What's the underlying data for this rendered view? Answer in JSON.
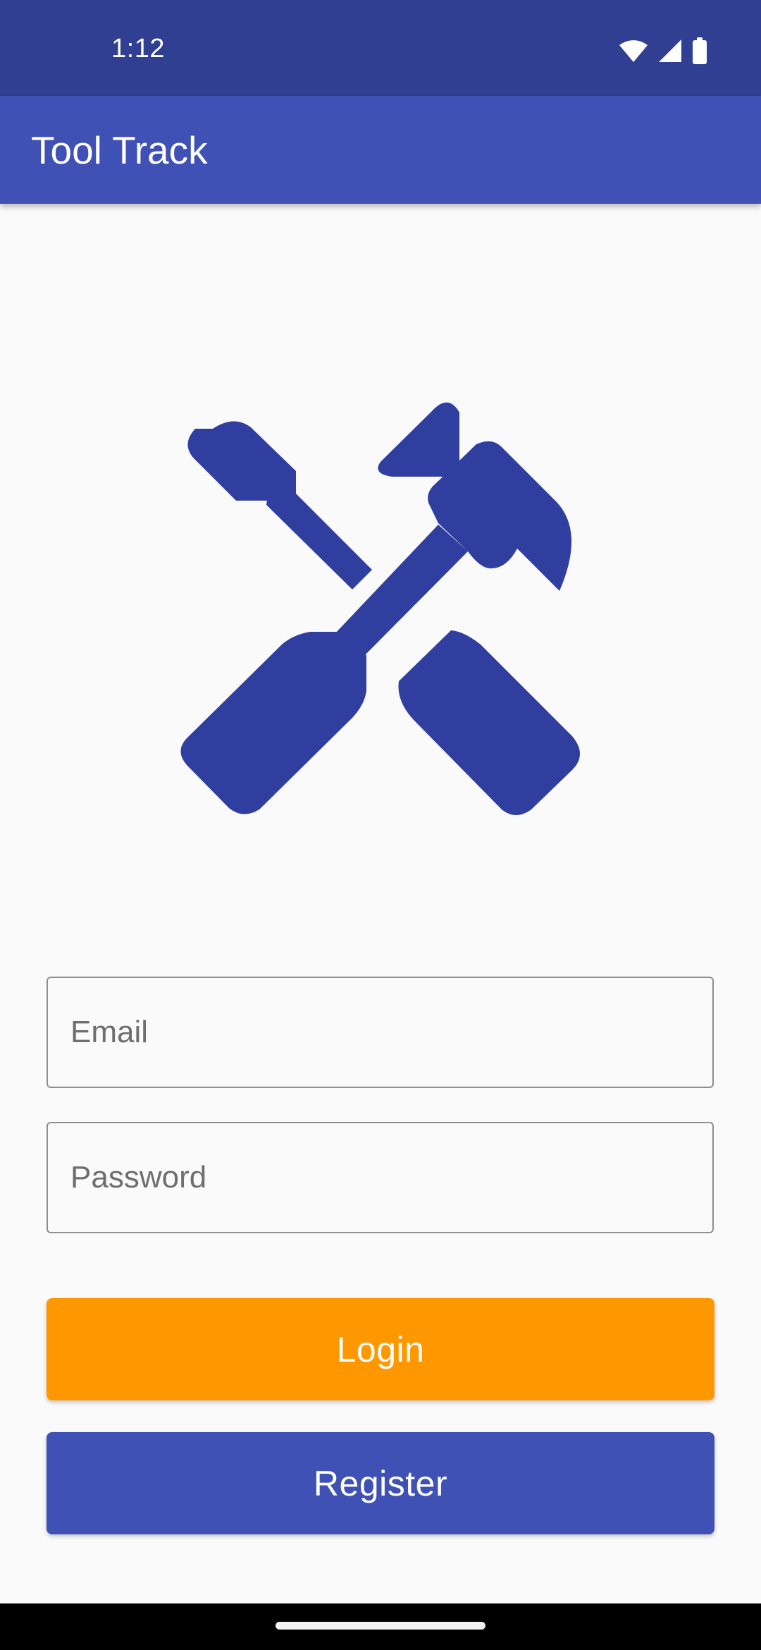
{
  "status_bar": {
    "time": "1:12",
    "icons": [
      "wifi-icon",
      "cell-signal-icon",
      "battery-icon"
    ]
  },
  "app_bar": {
    "title": "Tool Track"
  },
  "logo": {
    "icon": "tools-hammer-screwdriver-icon",
    "color": "#303f9f"
  },
  "form": {
    "email_placeholder": "Email",
    "email_value": "",
    "password_placeholder": "Password",
    "password_value": ""
  },
  "buttons": {
    "login_label": "Login",
    "register_label": "Register"
  },
  "colors": {
    "status_bar": "#303f92",
    "primary": "#3f51b5",
    "accent": "#ff9800",
    "background": "#fafafa"
  }
}
